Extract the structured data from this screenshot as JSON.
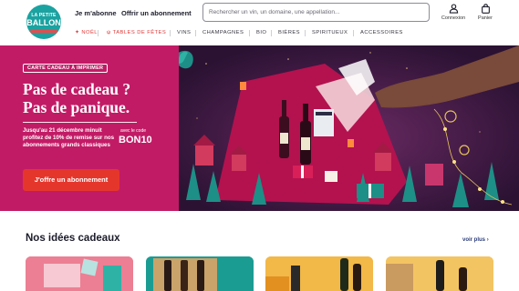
{
  "brand": {
    "logo_top": "LA PETITE",
    "logo_main": "BALLON",
    "teal": "#1aa3a1",
    "magenta": "#c21b66",
    "red": "#e5362c"
  },
  "header": {
    "links": [
      "Je m'abonne",
      "Offrir un abonnement"
    ],
    "search": {
      "placeholder": "Rechercher un vin, un domaine, une appellation..."
    },
    "account": {
      "label": "Connexion",
      "icon": "user-icon"
    },
    "cart": {
      "label": "Panier",
      "icon": "bag-icon"
    }
  },
  "nav": {
    "items": [
      {
        "label": "NOËL",
        "prefix": "✦"
      },
      {
        "label": "TABLES DE FÊTES",
        "prefix": "🍴"
      },
      {
        "label": "VINS"
      },
      {
        "label": "CHAMPAGNES"
      },
      {
        "label": "BIO"
      },
      {
        "label": "BIÈRES"
      },
      {
        "label": "SPIRITUEUX"
      },
      {
        "label": "ACCESSOIRES"
      }
    ]
  },
  "hero": {
    "badge": "CARTE CADEAU À IMPRIMER",
    "title_line1": "Pas de cadeau ?",
    "title_line2": "Pas de panique.",
    "text": "Jusqu'au 21 décembre minuit profitez de 10% de remise sur nos abonnements grands classiques",
    "code_label": "avec le code",
    "code": "BON10",
    "cta": "J'offre un abonnement",
    "slides": 4,
    "active_slide": 1
  },
  "ideas": {
    "title": "Nos idées cadeaux",
    "see_more": "voir plus",
    "cards": [
      {
        "color": "#e3576f"
      },
      {
        "color": "#1b9c93"
      },
      {
        "color": "#f2a93b"
      },
      {
        "color": "#efb13a"
      }
    ]
  }
}
